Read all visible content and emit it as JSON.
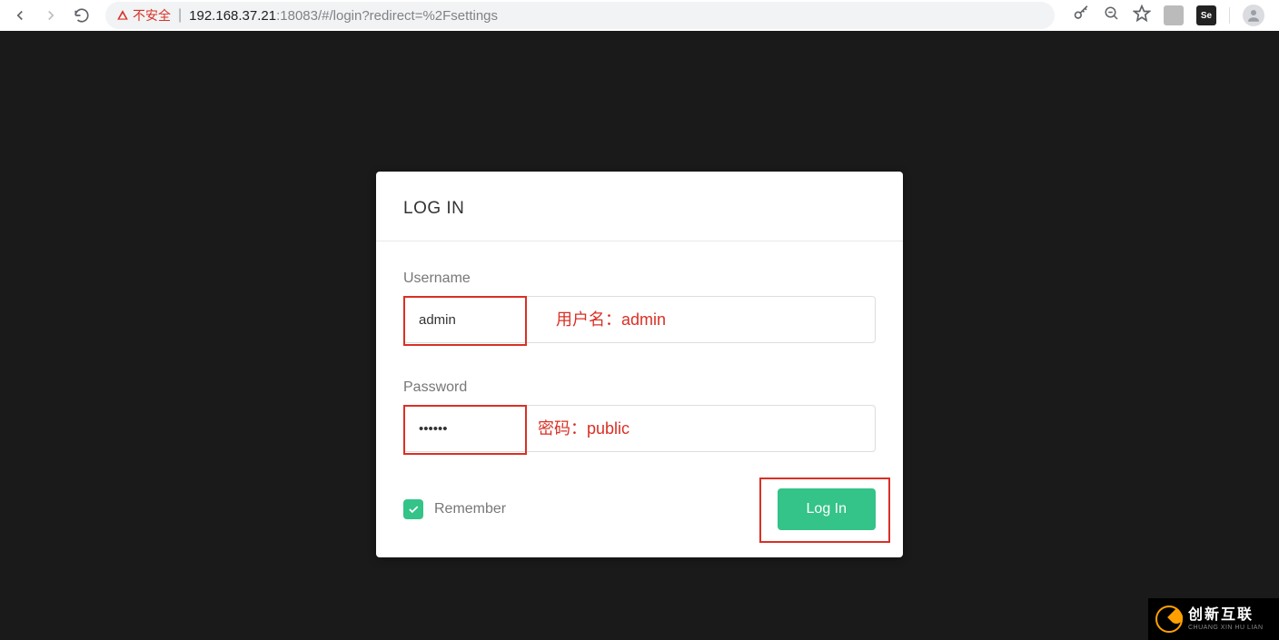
{
  "browser": {
    "security_label": "不安全",
    "url_host": "192.168.37.21",
    "url_path": ":18083/#/login?redirect=%2Fsettings"
  },
  "login": {
    "title": "LOG IN",
    "username_label": "Username",
    "username_value": "admin",
    "password_label": "Password",
    "password_value": "••••••",
    "remember_label": "Remember",
    "remember_checked": true,
    "submit_label": "Log In"
  },
  "annotations": {
    "username": "用户名：admin",
    "password": "密码：public",
    "colors": {
      "highlight": "#d93025"
    }
  },
  "watermark": {
    "cn": "创新互联",
    "en": "CHUANG XIN HU LIAN"
  }
}
